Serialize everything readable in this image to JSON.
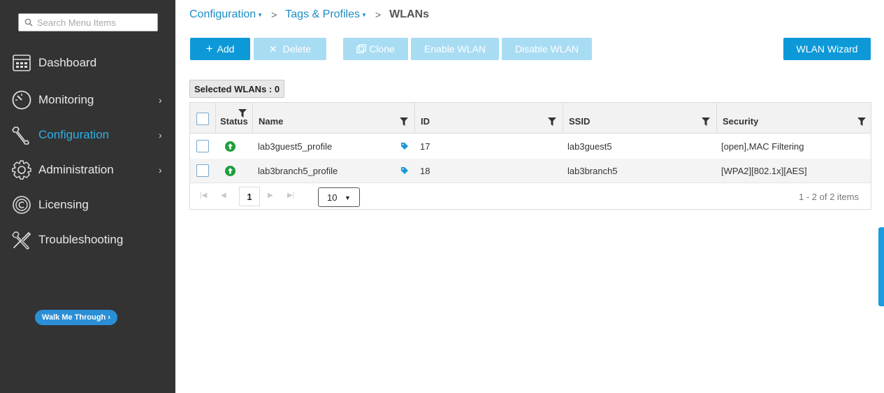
{
  "sidebar": {
    "search_placeholder": "Search Menu Items",
    "items": [
      {
        "label": "Dashboard",
        "icon": "dashboard-icon"
      },
      {
        "label": "Monitoring",
        "icon": "gauge-icon",
        "chevron": "›"
      },
      {
        "label": "Configuration",
        "icon": "wrench-icon",
        "chevron": "›",
        "active": true
      },
      {
        "label": "Administration",
        "icon": "gear-icon",
        "chevron": "›"
      },
      {
        "label": "Licensing",
        "icon": "license-icon"
      },
      {
        "label": "Troubleshooting",
        "icon": "tools-icon"
      }
    ],
    "walk_button": "Walk Me Through ›"
  },
  "breadcrumb": {
    "items": [
      "Configuration",
      "Tags & Profiles"
    ],
    "current": "WLANs",
    "separator": ">"
  },
  "toolbar": {
    "add": "Add",
    "delete": "Delete",
    "clone": "Clone",
    "enable": "Enable WLAN",
    "disable": "Disable WLAN",
    "wizard": "WLAN Wizard"
  },
  "selected_label": "Selected WLANs : 0",
  "table": {
    "columns": [
      "Status",
      "Name",
      "ID",
      "SSID",
      "Security"
    ],
    "rows": [
      {
        "name": "lab3guest5_profile",
        "id": "17",
        "ssid": "lab3guest5",
        "security": "[open],MAC Filtering",
        "status": "up"
      },
      {
        "name": "lab3branch5_profile",
        "id": "18",
        "ssid": "lab3branch5",
        "security": "[WPA2][802.1x][AES]",
        "status": "up"
      }
    ]
  },
  "pager": {
    "current_page": "1",
    "page_size": "10",
    "info": "1 - 2 of 2 items"
  },
  "colors": {
    "sidebar_bg": "#333333",
    "accent": "#0d99d8",
    "active_nav": "#2bb0e6",
    "status_up": "#1e9e3c"
  }
}
